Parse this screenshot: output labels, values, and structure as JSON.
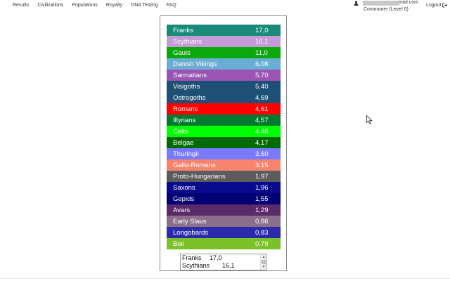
{
  "nav": {
    "links": [
      "Results",
      "Civilizations",
      "Populations",
      "Royalty",
      "DNA Testing",
      "FAQ"
    ]
  },
  "user": {
    "email_suffix": "mail.com",
    "level": "Commoner (Level 0)",
    "logout": "Logout"
  },
  "rows": [
    {
      "name": "Franks",
      "value": "17,0",
      "color": "#1a8a78"
    },
    {
      "name": "Scythians",
      "value": "16,1",
      "color": "#c49bd6"
    },
    {
      "name": "Gauls",
      "value": "11,0",
      "color": "#0aa80a"
    },
    {
      "name": "Danish Vikings",
      "value": "6,08",
      "color": "#6aaed4"
    },
    {
      "name": "Sarmatians",
      "value": "5,70",
      "color": "#9a55b4"
    },
    {
      "name": "Visigoths",
      "value": "5,40",
      "color": "#1e4f74"
    },
    {
      "name": "Ostrogoths",
      "value": "4,69",
      "color": "#1e4f74"
    },
    {
      "name": "Romans",
      "value": "4,61",
      "color": "#ff0000"
    },
    {
      "name": "Illyrians",
      "value": "4,57",
      "color": "#007a32"
    },
    {
      "name": "Celts",
      "value": "4,48",
      "color": "#00ff00"
    },
    {
      "name": "Belgae",
      "value": "4,17",
      "color": "#006c00"
    },
    {
      "name": "Thuringii",
      "value": "3,60",
      "color": "#7a7aff"
    },
    {
      "name": "Gallo-Romans",
      "value": "3,15",
      "color": "#f7846e"
    },
    {
      "name": "Proto-Hungarians",
      "value": "1,97",
      "color": "#5c5c5c"
    },
    {
      "name": "Saxons",
      "value": "1,96",
      "color": "#0a0a8c"
    },
    {
      "name": "Gepids",
      "value": "1,55",
      "color": "#000074"
    },
    {
      "name": "Avars",
      "value": "1,29",
      "color": "#5a2a6a"
    },
    {
      "name": "Early Slavs",
      "value": "0,86",
      "color": "#8a6f8a"
    },
    {
      "name": "Longobards",
      "value": "0,83",
      "color": "#2a2aaa"
    },
    {
      "name": "Boii",
      "value": "0,79",
      "color": "#7cc02a"
    }
  ],
  "mini_list": [
    {
      "name": "Franks",
      "value": "17,0"
    },
    {
      "name": "Scythians",
      "value": "16,1"
    }
  ],
  "icons": {
    "user": "user-icon",
    "logout": "logout-icon",
    "cursor": "mouse-cursor-icon"
  }
}
